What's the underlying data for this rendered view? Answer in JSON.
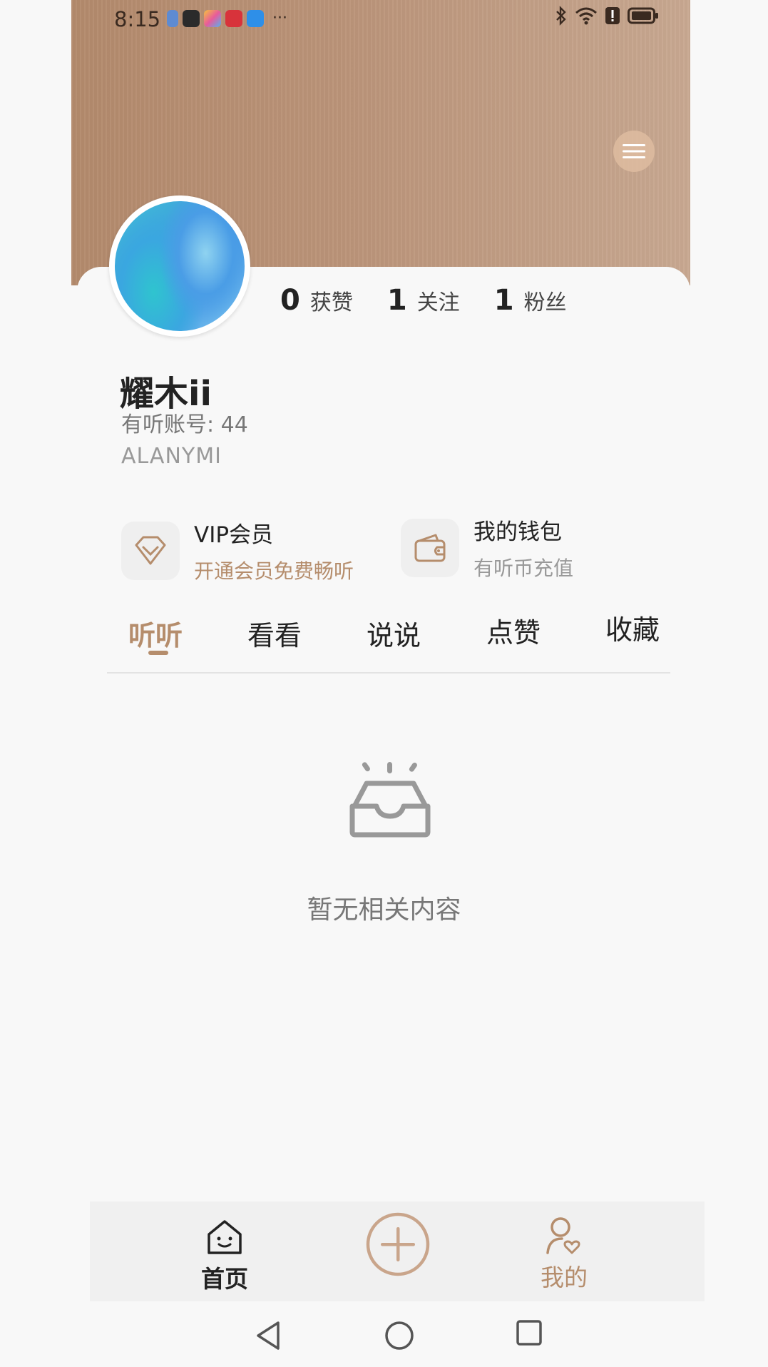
{
  "status_bar": {
    "time": "8:15",
    "more": "···"
  },
  "profile": {
    "username": "耀木ii",
    "account": "有听账号: 44",
    "bio": "ALANYMI"
  },
  "stats": [
    {
      "value": "0",
      "label": "获赞"
    },
    {
      "value": "1",
      "label": "关注"
    },
    {
      "value": "1",
      "label": "粉丝"
    }
  ],
  "features": {
    "vip": {
      "title": "VIP会员",
      "subtitle": "开通会员免费畅听"
    },
    "wallet": {
      "title": "我的钱包",
      "subtitle": "有听币充值"
    }
  },
  "tabs": [
    "听听",
    "看看",
    "说说",
    "点赞",
    "收藏"
  ],
  "active_tab": "听听",
  "empty_state": {
    "text": "暂无相关内容",
    "icon": "empty-inbox-icon"
  },
  "bottom_nav": {
    "home": "首页",
    "mine": "我的"
  },
  "colors": {
    "accent": "#b58d6c",
    "banner": "#bb9479",
    "background": "#f8f8f8"
  }
}
